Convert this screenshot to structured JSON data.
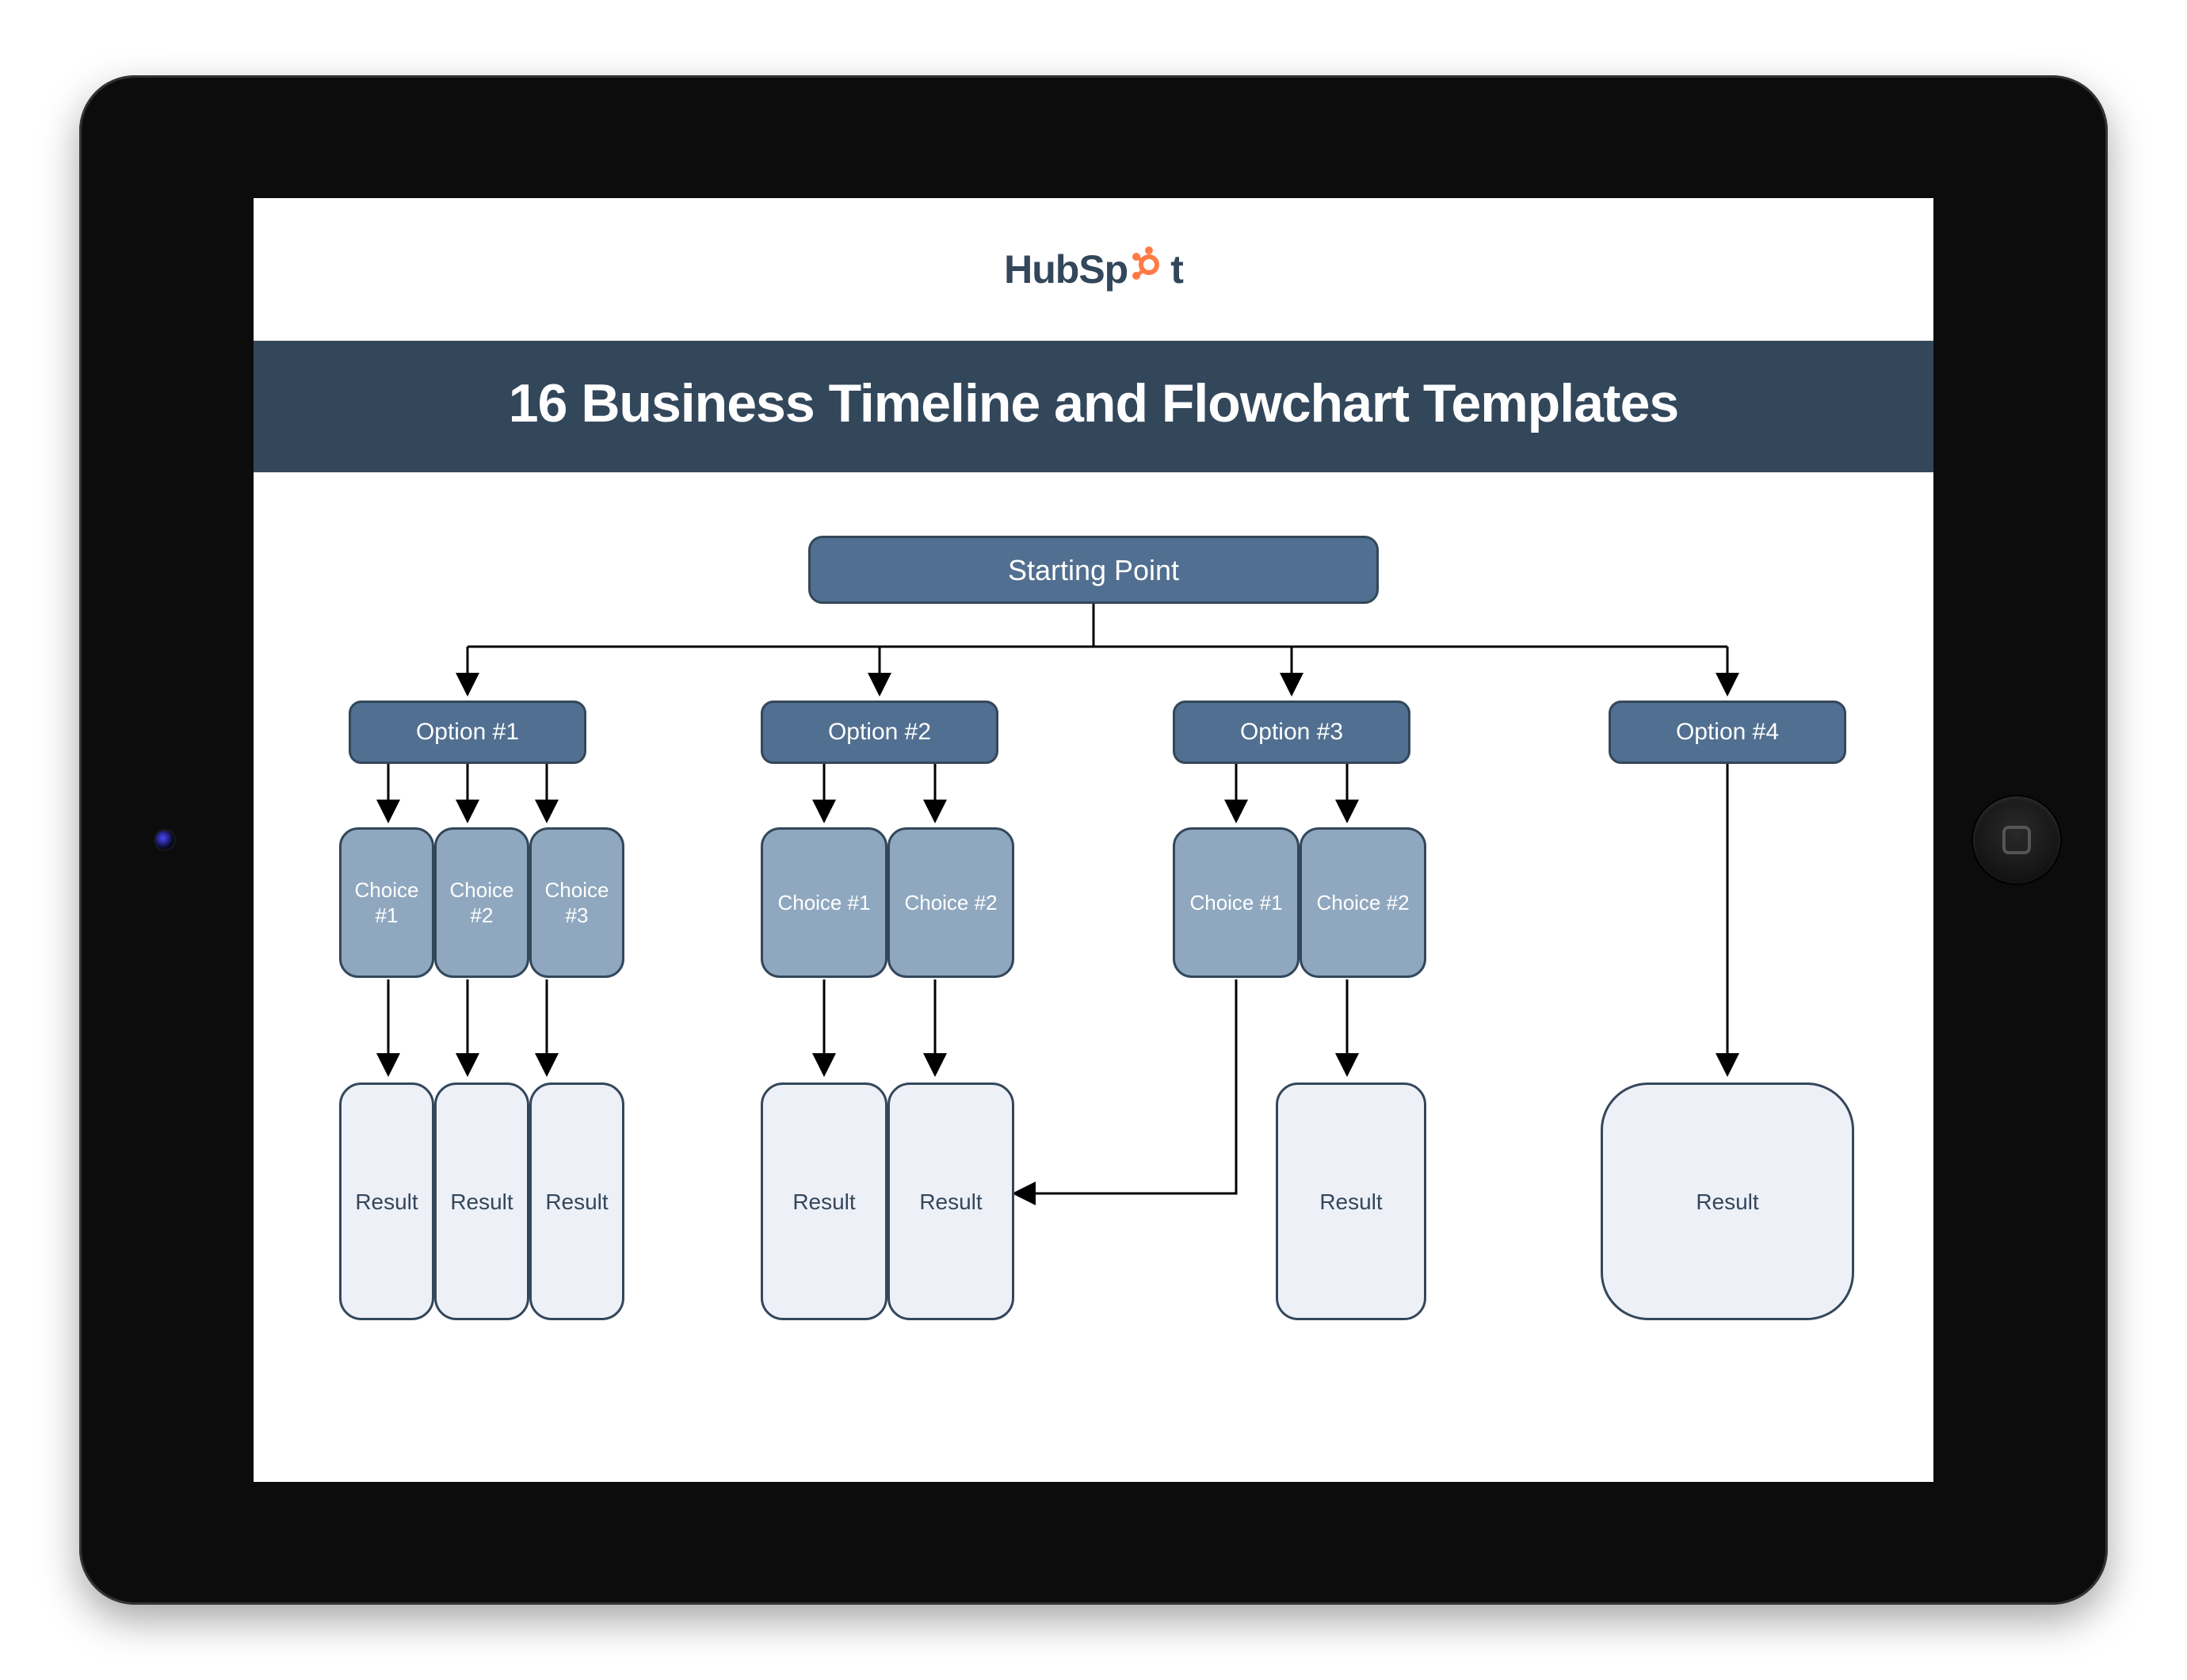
{
  "brand": {
    "name_part1": "HubSp",
    "name_part2": "t"
  },
  "title": "16 Business Timeline and Flowchart Templates",
  "flow": {
    "start": "Starting Point",
    "options": [
      "Option #1",
      "Option #2",
      "Option #3",
      "Option #4"
    ],
    "branch1": {
      "choices": [
        "Choice #1",
        "Choice #2",
        "Choice #3"
      ],
      "results": [
        "Result",
        "Result",
        "Result"
      ]
    },
    "branch2": {
      "choices": [
        "Choice #1",
        "Choice #2"
      ],
      "results": [
        "Result",
        "Result"
      ]
    },
    "branch3": {
      "choices": [
        "Choice #1",
        "Choice #2"
      ],
      "results": [
        "Result"
      ]
    },
    "branch4": {
      "results": [
        "Result"
      ]
    }
  }
}
